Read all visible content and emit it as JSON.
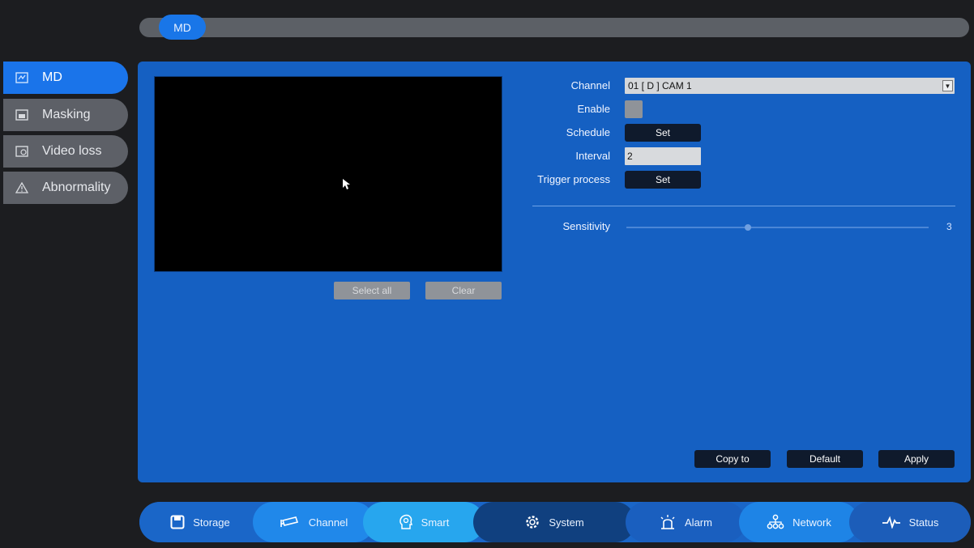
{
  "top_tab": {
    "label": "MD"
  },
  "sidebar": {
    "items": [
      {
        "label": "MD",
        "icon": "motion-icon",
        "active": true
      },
      {
        "label": "Masking",
        "icon": "masking-icon",
        "active": false
      },
      {
        "label": "Video loss",
        "icon": "video-loss-icon",
        "active": false
      },
      {
        "label": "Abnormality",
        "icon": "warning-icon",
        "active": false
      }
    ]
  },
  "preview": {
    "select_all": "Select all",
    "clear": "Clear"
  },
  "form": {
    "channel_label": "Channel",
    "channel_value": "01 [ D ] CAM 1",
    "enable_label": "Enable",
    "enable_checked": false,
    "schedule_label": "Schedule",
    "schedule_button": "Set",
    "interval_label": "Interval",
    "interval_value": "2",
    "trigger_label": "Trigger process",
    "trigger_button": "Set",
    "sensitivity_label": "Sensitivity",
    "sensitivity_value": "3",
    "sensitivity_level": 0.4
  },
  "actions": {
    "copy_to": "Copy to",
    "default": "Default",
    "apply": "Apply"
  },
  "bottom_nav": {
    "items": [
      {
        "label": "Storage",
        "icon": "floppy-icon"
      },
      {
        "label": "Channel",
        "icon": "camera-icon"
      },
      {
        "label": "Smart",
        "icon": "smart-head-icon"
      },
      {
        "label": "System",
        "icon": "gear-icon"
      },
      {
        "label": "Alarm",
        "icon": "alarm-icon"
      },
      {
        "label": "Network",
        "icon": "network-icon"
      },
      {
        "label": "Status",
        "icon": "pulse-icon"
      }
    ]
  },
  "colors": {
    "panel": "#1560c2",
    "active_tab": "#1976e8",
    "sidebar_inactive": "#5d6067",
    "background": "#1c1d20"
  }
}
